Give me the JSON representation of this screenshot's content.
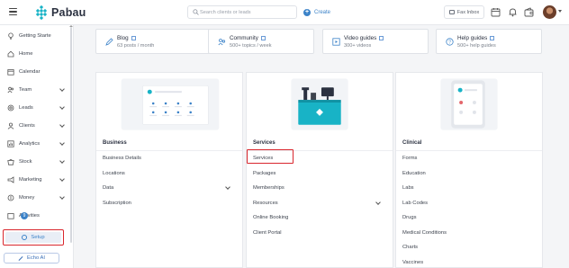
{
  "topbar": {
    "brand": "Pabau",
    "search_placeholder": "Search clients or leads",
    "create_label": "Create",
    "fax_label": "Fax Inbox",
    "icons": [
      "menu-icon",
      "calendar-icon",
      "bell-icon",
      "wallet-icon",
      "avatar"
    ]
  },
  "sidebar": {
    "items": [
      {
        "label": "Getting Starte",
        "icon": "lightbulb-icon",
        "chevron": false
      },
      {
        "label": "Home",
        "icon": "home-icon",
        "chevron": false
      },
      {
        "label": "Calendar",
        "icon": "calendar-icon",
        "chevron": false
      },
      {
        "label": "Team",
        "icon": "team-icon",
        "chevron": true
      },
      {
        "label": "Leads",
        "icon": "target-icon",
        "chevron": true
      },
      {
        "label": "Clients",
        "icon": "user-icon",
        "chevron": true
      },
      {
        "label": "Analytics",
        "icon": "analytics-icon",
        "chevron": true
      },
      {
        "label": "Stock",
        "icon": "stock-icon",
        "chevron": true
      },
      {
        "label": "Marketing",
        "icon": "megaphone-icon",
        "chevron": true
      },
      {
        "label": "Money",
        "icon": "money-icon",
        "chevron": true
      },
      {
        "label": "Activities",
        "icon": "activities-icon",
        "chevron": false,
        "badge": "9"
      }
    ],
    "setup_label": "Setup",
    "echo_label": "Echo AI"
  },
  "resources": [
    {
      "title": "Blog",
      "subtitle": "63 posts / month",
      "icon": "pen-icon"
    },
    {
      "title": "Community",
      "subtitle": "500+ topics / week",
      "icon": "community-icon"
    },
    {
      "title": "Video guides",
      "subtitle": "300+ videos",
      "icon": "video-icon"
    },
    {
      "title": "Help guides",
      "subtitle": "500+ help guides",
      "icon": "help-icon"
    }
  ],
  "columns": [
    {
      "title": "Business",
      "items": [
        {
          "label": "Business Details"
        },
        {
          "label": "Locations"
        },
        {
          "label": "Data",
          "chevron": true
        },
        {
          "label": "Subscription"
        }
      ]
    },
    {
      "title": "Services",
      "items": [
        {
          "label": "Services"
        },
        {
          "label": "Packages"
        },
        {
          "label": "Memberships"
        },
        {
          "label": "Resources",
          "chevron": true
        },
        {
          "label": "Online Booking"
        },
        {
          "label": "Client Portal"
        }
      ]
    },
    {
      "title": "Clinical",
      "items": [
        {
          "label": "Forms"
        },
        {
          "label": "Education"
        },
        {
          "label": "Labs"
        },
        {
          "label": "Lab Codes"
        },
        {
          "label": "Drugs"
        },
        {
          "label": "Medical Conditions"
        },
        {
          "label": "Charts"
        },
        {
          "label": "Vaccines"
        }
      ]
    }
  ],
  "colors": {
    "accent": "#3b82c8",
    "highlight": "#d9262d",
    "brand_teal": "#18b3c6"
  }
}
